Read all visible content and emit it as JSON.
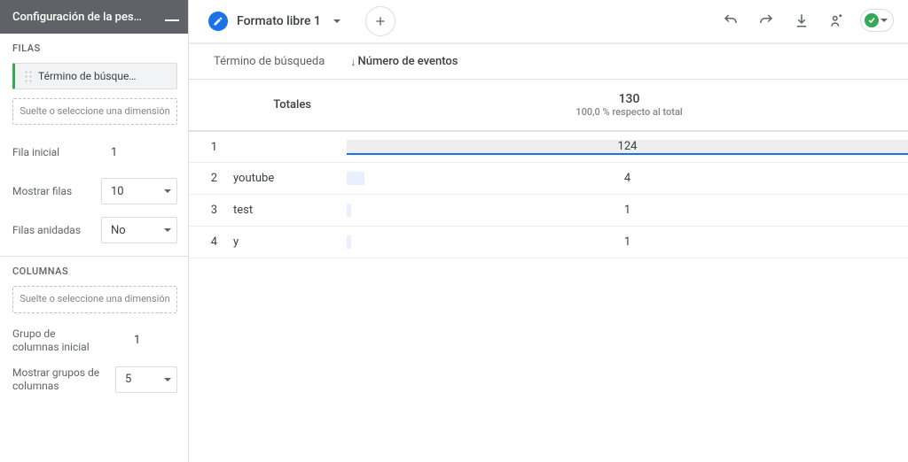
{
  "sidebar": {
    "header_title": "Configuración de la pes…",
    "rows": {
      "title": "FILAS",
      "chip_label": "Término de búsque…",
      "dropzone": "Suelte o seleccione una dimensión",
      "start_row_label": "Fila inicial",
      "start_row_value": "1",
      "show_rows_label": "Mostrar filas",
      "show_rows_value": "10",
      "nested_rows_label": "Filas anidadas",
      "nested_rows_value": "No"
    },
    "columns": {
      "title": "COLUMNAS",
      "dropzone": "Suelte o seleccione una dimensión",
      "col_group_start_label": "Grupo de columnas inicial",
      "col_group_start_value": "1",
      "show_col_groups_label": "Mostrar grupos de columnas",
      "show_col_groups_value": "5"
    }
  },
  "tab": {
    "name": "Formato libre 1"
  },
  "table": {
    "dim_header": "Término de búsqueda",
    "metric_header": "Número de eventos",
    "totals_label": "Totales",
    "totals_value": "130",
    "totals_sub": "100,0 % respecto al total"
  },
  "chart_data": {
    "type": "table",
    "dimension": "Término de búsqueda",
    "metric": "Número de eventos",
    "total": 130,
    "rows": [
      {
        "index": 1,
        "term": "",
        "value": 124
      },
      {
        "index": 2,
        "term": "youtube",
        "value": 4
      },
      {
        "index": 3,
        "term": "test",
        "value": 1
      },
      {
        "index": 4,
        "term": "y",
        "value": 1
      }
    ]
  }
}
